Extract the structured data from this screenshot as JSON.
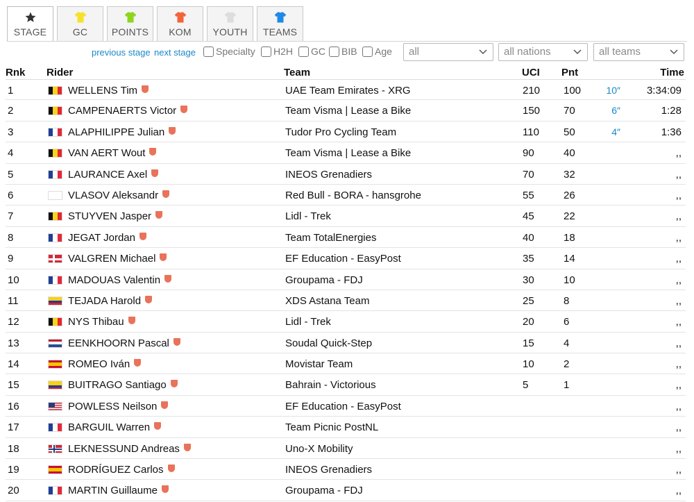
{
  "tabs": [
    {
      "label": "STAGE",
      "icon": "star-icon",
      "color": "#333333",
      "active": true
    },
    {
      "label": "GC",
      "icon": "jersey-icon",
      "color": "#f4e22a"
    },
    {
      "label": "POINTS",
      "icon": "jersey-icon",
      "color": "#8ed61c"
    },
    {
      "label": "KOM",
      "icon": "jersey-icon",
      "color": "#f2643c"
    },
    {
      "label": "YOUTH",
      "icon": "jersey-icon",
      "color": "#dddddd"
    },
    {
      "label": "TEAMS",
      "icon": "jersey-icon",
      "color": "#1e8ae6"
    }
  ],
  "nav": {
    "previous": "previous stage",
    "next": "next stage"
  },
  "checkboxes": [
    "Specialty",
    "H2H",
    "GC",
    "BIB",
    "Age"
  ],
  "selects": {
    "filter": "all",
    "nations": "all nations",
    "teams": "all teams"
  },
  "headers": {
    "rnk": "Rnk",
    "rider": "Rider",
    "team": "Team",
    "uci": "UCI",
    "pnt": "Pnt",
    "time": "Time"
  },
  "rows": [
    {
      "rnk": "1",
      "flag": "be",
      "rider": "WELLENS Tim",
      "team": "UAE Team Emirates - XRG",
      "uci": "210",
      "pnt": "100",
      "bonus": "10″",
      "time": "3:34:09"
    },
    {
      "rnk": "2",
      "flag": "be",
      "rider": "CAMPENAERTS Victor",
      "team": "Team Visma | Lease a Bike",
      "uci": "150",
      "pnt": "70",
      "bonus": "6″",
      "time": "1:28"
    },
    {
      "rnk": "3",
      "flag": "fr",
      "rider": "ALAPHILIPPE Julian",
      "team": "Tudor Pro Cycling Team",
      "uci": "110",
      "pnt": "50",
      "bonus": "4″",
      "time": "1:36"
    },
    {
      "rnk": "4",
      "flag": "be",
      "rider": "VAN AERT Wout",
      "team": "Team Visma | Lease a Bike",
      "uci": "90",
      "pnt": "40",
      "bonus": "",
      "time": ",,"
    },
    {
      "rnk": "5",
      "flag": "fr",
      "rider": "LAURANCE Axel",
      "team": "INEOS Grenadiers",
      "uci": "70",
      "pnt": "32",
      "bonus": "",
      "time": ",,"
    },
    {
      "rnk": "6",
      "flag": "none",
      "rider": "VLASOV Aleksandr",
      "team": "Red Bull - BORA - hansgrohe",
      "uci": "55",
      "pnt": "26",
      "bonus": "",
      "time": ",,"
    },
    {
      "rnk": "7",
      "flag": "be",
      "rider": "STUYVEN Jasper",
      "team": "Lidl - Trek",
      "uci": "45",
      "pnt": "22",
      "bonus": "",
      "time": ",,"
    },
    {
      "rnk": "8",
      "flag": "fr",
      "rider": "JEGAT Jordan",
      "team": "Team TotalEnergies",
      "uci": "40",
      "pnt": "18",
      "bonus": "",
      "time": ",,"
    },
    {
      "rnk": "9",
      "flag": "dk",
      "rider": "VALGREN Michael",
      "team": "EF Education - EasyPost",
      "uci": "35",
      "pnt": "14",
      "bonus": "",
      "time": ",,"
    },
    {
      "rnk": "10",
      "flag": "fr",
      "rider": "MADOUAS Valentin",
      "team": "Groupama - FDJ",
      "uci": "30",
      "pnt": "10",
      "bonus": "",
      "time": ",,"
    },
    {
      "rnk": "11",
      "flag": "co",
      "rider": "TEJADA Harold",
      "team": "XDS Astana Team",
      "uci": "25",
      "pnt": "8",
      "bonus": "",
      "time": ",,"
    },
    {
      "rnk": "12",
      "flag": "be",
      "rider": "NYS Thibau",
      "team": "Lidl - Trek",
      "uci": "20",
      "pnt": "6",
      "bonus": "",
      "time": ",,"
    },
    {
      "rnk": "13",
      "flag": "nl",
      "rider": "EENKHOORN Pascal",
      "team": "Soudal Quick-Step",
      "uci": "15",
      "pnt": "4",
      "bonus": "",
      "time": ",,"
    },
    {
      "rnk": "14",
      "flag": "es",
      "rider": "ROMEO Iván",
      "team": "Movistar Team",
      "uci": "10",
      "pnt": "2",
      "bonus": "",
      "time": ",,"
    },
    {
      "rnk": "15",
      "flag": "co",
      "rider": "BUITRAGO Santiago",
      "team": "Bahrain - Victorious",
      "uci": "5",
      "pnt": "1",
      "bonus": "",
      "time": ",,"
    },
    {
      "rnk": "16",
      "flag": "us",
      "rider": "POWLESS Neilson",
      "team": "EF Education - EasyPost",
      "uci": "",
      "pnt": "",
      "bonus": "",
      "time": ",,"
    },
    {
      "rnk": "17",
      "flag": "fr",
      "rider": "BARGUIL Warren",
      "team": "Team Picnic PostNL",
      "uci": "",
      "pnt": "",
      "bonus": "",
      "time": ",,"
    },
    {
      "rnk": "18",
      "flag": "no",
      "rider": "LEKNESSUND Andreas",
      "team": "Uno-X Mobility",
      "uci": "",
      "pnt": "",
      "bonus": "",
      "time": ",,"
    },
    {
      "rnk": "19",
      "flag": "es",
      "rider": "RODRÍGUEZ Carlos",
      "team": "INEOS Grenadiers",
      "uci": "",
      "pnt": "",
      "bonus": "",
      "time": ",,"
    },
    {
      "rnk": "20",
      "flag": "fr",
      "rider": "MARTIN Guillaume",
      "team": "Groupama - FDJ",
      "uci": "",
      "pnt": "",
      "bonus": "",
      "time": ",,"
    }
  ]
}
